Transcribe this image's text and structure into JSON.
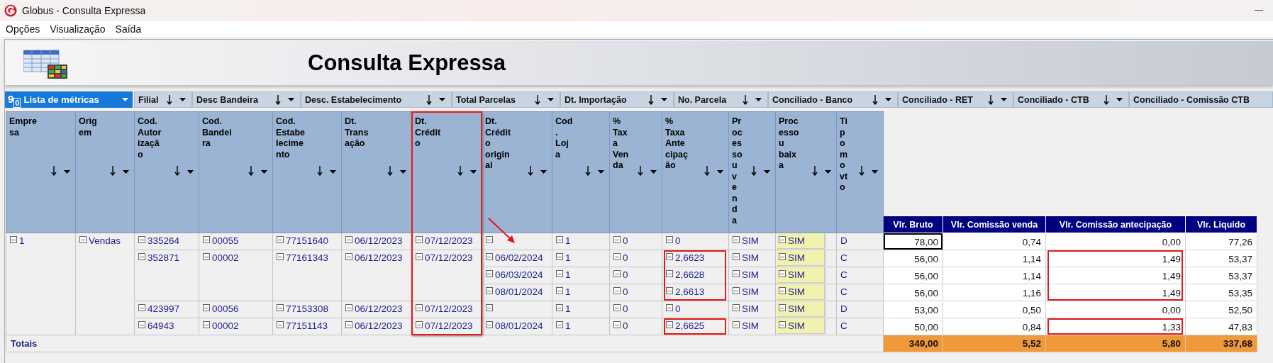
{
  "window": {
    "title": "Globus - Consulta Expressa"
  },
  "menu": [
    {
      "label": "Opções"
    },
    {
      "label": "Visualização"
    },
    {
      "label": "Saída"
    }
  ],
  "banner": {
    "title": "Consulta Expressa"
  },
  "metrics_button": {
    "icon": "9$_{0}$",
    "label": "Lista de métricas"
  },
  "filter_fields": [
    {
      "label": "Filial",
      "kind": "sortable"
    },
    {
      "label": "Desc Bandeira",
      "kind": "sortable"
    },
    {
      "label": "Desc. Estabelecimento",
      "kind": "sortable"
    },
    {
      "label": "Total Parcelas",
      "kind": "sortable"
    },
    {
      "label": "Dt. Importação",
      "kind": "sortable"
    },
    {
      "label": "No. Parcela",
      "kind": "sortable"
    },
    {
      "label": "Conciliado - Banco",
      "kind": "sortable"
    },
    {
      "label": "Conciliado - RET",
      "kind": "sortable"
    },
    {
      "label": "Conciliado - CTB",
      "kind": "sortable"
    },
    {
      "label": "Conciliado - Comissão CTB",
      "kind": "plain"
    }
  ],
  "pivot": {
    "columns": [
      {
        "label": "Empre\nsa",
        "kind": "node",
        "highlighted": false
      },
      {
        "label": "Orig\nem",
        "kind": "node",
        "highlighted": false
      },
      {
        "label": "Cod.\nAutor\nizaçã\no",
        "kind": "node",
        "highlighted": false
      },
      {
        "label": "Cod.\nBandei\nra",
        "kind": "node",
        "highlighted": false
      },
      {
        "label": "Cod.\nEstabe\nlecime\nnto",
        "kind": "node",
        "highlighted": false
      },
      {
        "label": "Dt.\nTrans\nação",
        "kind": "node",
        "highlighted": false
      },
      {
        "label": "Dt.\nCrédit\no",
        "kind": "node",
        "highlighted": true
      },
      {
        "label": "Dt.\nCrédit\no\norigin\nal",
        "kind": "node",
        "highlighted": false
      },
      {
        "label": "Cod\n.\nLoj\na",
        "kind": "node",
        "highlighted": false
      },
      {
        "label": "%\nTax\na\nVen\nda",
        "kind": "node",
        "highlighted": false
      },
      {
        "label": "%\nTaxa\nAnte\ncipaç\não",
        "kind": "marked",
        "highlighted": false
      },
      {
        "label": "Pr\noc\nes\nso\nu\nv\ne\nn\nd\na",
        "kind": "node",
        "highlighted": false
      },
      {
        "label": "Proc\nesso\nu\nbaix\na",
        "kind": "shaded",
        "highlighted": false
      },
      {
        "label": "Ti\np\no\nm\no\nvt\no",
        "kind": "plain",
        "highlighted": false
      }
    ],
    "measures": [
      {
        "label": "Vlr. Bruto",
        "kind": "value"
      },
      {
        "label": "Vlr. Comissão venda",
        "kind": "value"
      },
      {
        "label": "Vlr. Comissão antecipação",
        "kind": "marked"
      },
      {
        "label": "Vlr. Liquido",
        "kind": "value"
      }
    ],
    "groups": [
      {
        "cells": [
          {
            "text": "1"
          },
          {
            "text": "Vendas"
          }
        ],
        "children": [
          {
            "cells": [
              {
                "text": "335264"
              },
              {
                "text": "00055"
              },
              {
                "text": "77151640"
              },
              {
                "text": "06/12/2023"
              },
              {
                "text": "07/12/2023"
              }
            ],
            "children": [
              {
                "cells": [
                  {},
                  {
                    "text": "1"
                  },
                  {
                    "text": "0"
                  },
                  {
                    "text": "0"
                  },
                  {
                    "text": "SIM"
                  },
                  {
                    "text": "SIM"
                  },
                  {
                    "text": "D"
                  }
                ],
                "values": [
                  "78,00",
                  "0,74",
                  "0,00",
                  "77,26"
                ],
                "flagged": false,
                "focused": true,
                "pointed": true
              }
            ]
          },
          {
            "cells": [
              {
                "text": "352871"
              },
              {
                "text": "00002"
              },
              {
                "text": "77161343"
              },
              {
                "text": "06/12/2023"
              },
              {
                "text": "07/12/2023"
              }
            ],
            "children": [
              {
                "cells": [
                  {
                    "text": "06/02/2024"
                  },
                  {
                    "text": "1"
                  },
                  {
                    "text": "0"
                  },
                  {
                    "text": "2,6623"
                  },
                  {
                    "text": "SIM"
                  },
                  {
                    "text": "SIM"
                  },
                  {
                    "text": "C"
                  }
                ],
                "values": [
                  "56,00",
                  "1,14",
                  "1,49",
                  "53,37"
                ],
                "flagged": true,
                "focused": false,
                "pointed": false
              },
              {
                "cells": [
                  {
                    "text": "06/03/2024"
                  },
                  {
                    "text": "1"
                  },
                  {
                    "text": "0"
                  },
                  {
                    "text": "2,6628"
                  },
                  {
                    "text": "SIM"
                  },
                  {
                    "text": "SIM"
                  },
                  {
                    "text": "C"
                  }
                ],
                "values": [
                  "56,00",
                  "1,14",
                  "1,49",
                  "53,37"
                ],
                "flagged": true,
                "focused": false,
                "pointed": false
              },
              {
                "cells": [
                  {
                    "text": "08/01/2024"
                  },
                  {
                    "text": "1"
                  },
                  {
                    "text": "0"
                  },
                  {
                    "text": "2,6613"
                  },
                  {
                    "text": "SIM"
                  },
                  {
                    "text": "SIM"
                  },
                  {
                    "text": "C"
                  }
                ],
                "values": [
                  "56,00",
                  "1,16",
                  "1,49",
                  "53,35"
                ],
                "flagged": true,
                "focused": false,
                "pointed": false
              }
            ]
          },
          {
            "cells": [
              {
                "text": "423997"
              },
              {
                "text": "00056"
              },
              {
                "text": "77153308"
              },
              {
                "text": "06/12/2023"
              },
              {
                "text": "07/12/2023"
              }
            ],
            "children": [
              {
                "cells": [
                  {},
                  {
                    "text": "1"
                  },
                  {
                    "text": "0"
                  },
                  {
                    "text": "0"
                  },
                  {
                    "text": "SIM"
                  },
                  {
                    "text": "SIM"
                  },
                  {
                    "text": "D"
                  }
                ],
                "values": [
                  "53,00",
                  "0,50",
                  "0,00",
                  "52,50"
                ],
                "flagged": false,
                "focused": false,
                "pointed": false
              }
            ]
          },
          {
            "cells": [
              {
                "text": "64943"
              },
              {
                "text": "00002"
              },
              {
                "text": "77151143"
              },
              {
                "text": "06/12/2023"
              },
              {
                "text": "07/12/2023"
              }
            ],
            "children": [
              {
                "cells": [
                  {
                    "text": "08/01/2024"
                  },
                  {
                    "text": "1"
                  },
                  {
                    "text": "0"
                  },
                  {
                    "text": "2,6625"
                  },
                  {
                    "text": "SIM"
                  },
                  {
                    "text": "SIM"
                  },
                  {
                    "text": "C"
                  }
                ],
                "values": [
                  "50,00",
                  "0,84",
                  "1,33",
                  "47,83"
                ],
                "flagged": true,
                "focused": false,
                "pointed": false
              }
            ]
          }
        ]
      }
    ],
    "totals": {
      "label": "Totais",
      "values": [
        "349,00",
        "5,52",
        "5,80",
        "337,68"
      ]
    }
  }
}
